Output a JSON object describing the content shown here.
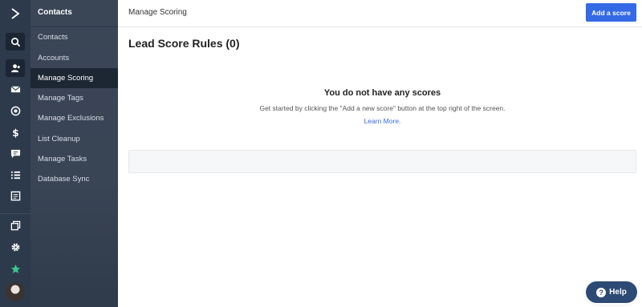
{
  "colors": {
    "rail": "#2d3a4b",
    "subnav": "#3a4556",
    "accent": "#356ae6",
    "help": "#2c4a74",
    "star": "#3ec78f"
  },
  "rail": {
    "icons": [
      "logo-chevron-icon",
      "search-icon",
      "contacts-icon",
      "mail-icon",
      "target-icon",
      "dollar-icon",
      "chat-icon",
      "list-icon",
      "report-icon",
      "copy-icon",
      "gear-icon",
      "star-icon",
      "avatar"
    ]
  },
  "subnav": {
    "title": "Contacts",
    "items": [
      {
        "label": "Contacts"
      },
      {
        "label": "Accounts"
      },
      {
        "label": "Manage Scoring"
      },
      {
        "label": "Manage Tags"
      },
      {
        "label": "Manage Exclusions"
      },
      {
        "label": "List Cleanup"
      },
      {
        "label": "Manage Tasks"
      },
      {
        "label": "Database Sync"
      }
    ]
  },
  "header": {
    "breadcrumb": "Manage Scoring",
    "add_button": "Add a score"
  },
  "main": {
    "title": "Lead Score Rules (0)",
    "empty_title": "You do not have any scores",
    "empty_text": "Get started by clicking the \"Add a new score\" button at the top right of the screen.",
    "learn_more": "Learn More."
  },
  "help": {
    "label": "Help",
    "icon": "?"
  }
}
